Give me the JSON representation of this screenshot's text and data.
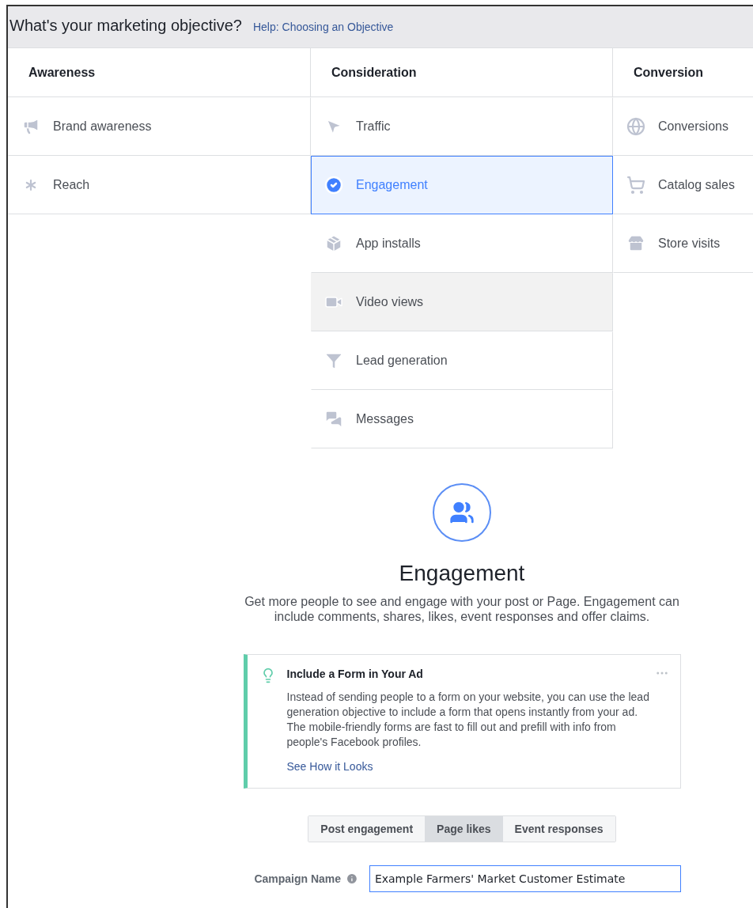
{
  "header": {
    "title": "What's your marketing objective?",
    "help_link": "Help: Choosing an Objective"
  },
  "columns": [
    {
      "heading": "Awareness",
      "items": [
        {
          "label": "Brand awareness",
          "selected": false,
          "highlighted": false
        },
        {
          "label": "Reach",
          "selected": false,
          "highlighted": false
        }
      ]
    },
    {
      "heading": "Consideration",
      "items": [
        {
          "label": "Traffic",
          "selected": false,
          "highlighted": false
        },
        {
          "label": "Engagement",
          "selected": true,
          "highlighted": false
        },
        {
          "label": "App installs",
          "selected": false,
          "highlighted": false
        },
        {
          "label": "Video views",
          "selected": false,
          "highlighted": true
        },
        {
          "label": "Lead generation",
          "selected": false,
          "highlighted": false
        },
        {
          "label": "Messages",
          "selected": false,
          "highlighted": false
        }
      ]
    },
    {
      "heading": "Conversion",
      "items": [
        {
          "label": "Conversions",
          "selected": false,
          "highlighted": false
        },
        {
          "label": "Catalog sales",
          "selected": false,
          "highlighted": false
        },
        {
          "label": "Store visits",
          "selected": false,
          "highlighted": false
        }
      ]
    }
  ],
  "detail": {
    "title": "Engagement",
    "description": "Get more people to see and engage with your post or Page. Engagement can include comments, shares, likes, event responses and offer claims."
  },
  "tip": {
    "title": "Include a Form in Your Ad",
    "body": "Instead of sending people to a form on your website, you can use the lead generation objective to include a form that opens instantly from your ad. The mobile-friendly forms are fast to fill out and prefill with info from people's Facebook profiles.",
    "link": "See How it Looks"
  },
  "subtypes": [
    {
      "label": "Post engagement",
      "selected": false
    },
    {
      "label": "Page likes",
      "selected": true
    },
    {
      "label": "Event responses",
      "selected": false
    }
  ],
  "campaign_name": {
    "label": "Campaign Name",
    "value": "Example Farmers' Market Customer Estimate"
  }
}
